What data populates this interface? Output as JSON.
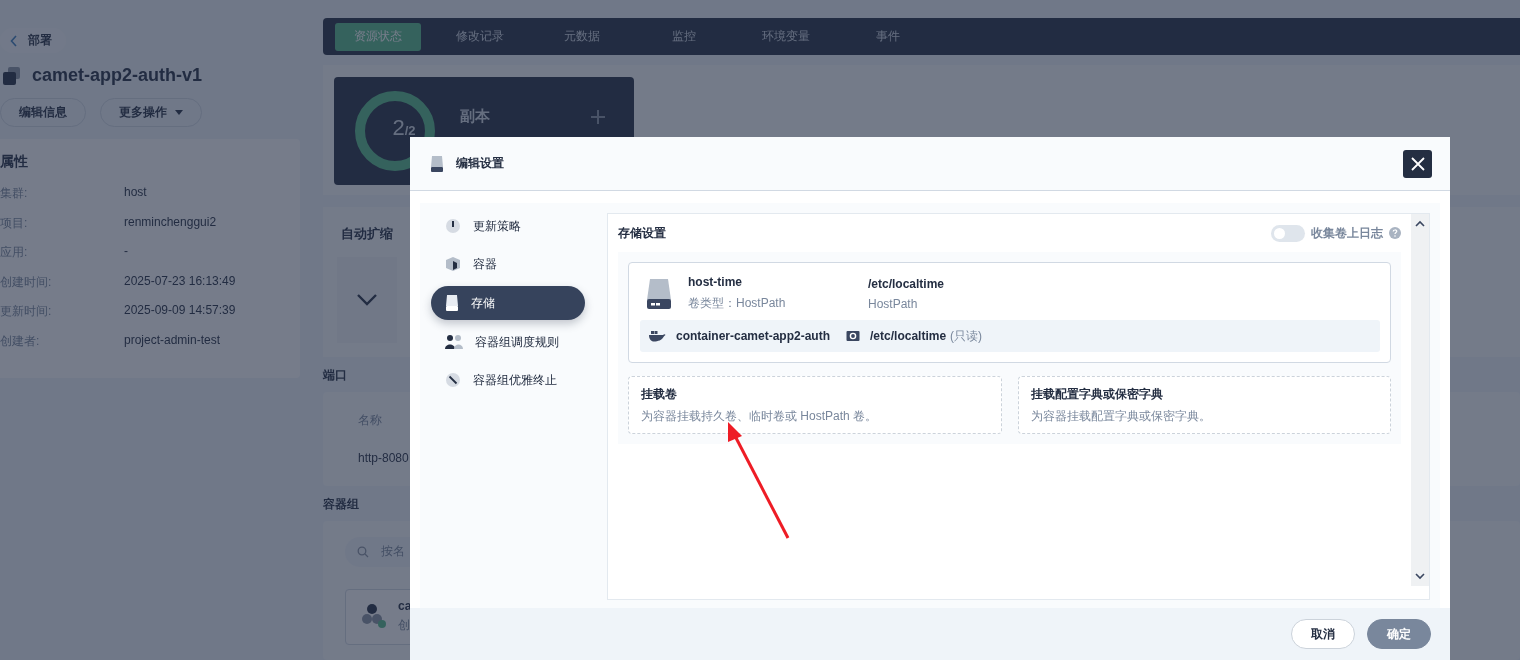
{
  "page": {
    "back_label": "部署",
    "title": "camet-app2-auth-v1",
    "actions": [
      {
        "label": "编辑信息",
        "kind": "plain"
      },
      {
        "label": "更多操作",
        "kind": "dropdown"
      }
    ],
    "properties": {
      "heading": "属性",
      "rows": [
        {
          "label": "集群:",
          "value": "host"
        },
        {
          "label": "项目:",
          "value": "renminchenggui2"
        },
        {
          "label": "应用:",
          "value": "-"
        },
        {
          "label": "创建时间:",
          "value": "2025-07-23 16:13:49"
        },
        {
          "label": "更新时间:",
          "value": "2025-09-09 14:57:39"
        },
        {
          "label": "创建者:",
          "value": "project-admin-test"
        }
      ]
    }
  },
  "tabs": [
    {
      "label": "资源状态",
      "selected": true
    },
    {
      "label": "修改记录",
      "selected": false
    },
    {
      "label": "元数据",
      "selected": false
    },
    {
      "label": "监控",
      "selected": false
    },
    {
      "label": "环境变量",
      "selected": false
    },
    {
      "label": "事件",
      "selected": false
    }
  ],
  "replicas": {
    "current": "2",
    "total": "/2",
    "title": "副本"
  },
  "autoscaling": {
    "title": "自动扩缩"
  },
  "ports": {
    "title": "端口",
    "column": "名称",
    "rows": [
      "http-8080"
    ]
  },
  "pods": {
    "title": "容器组",
    "search_placeholder": "按名",
    "card_name": "ca",
    "card_sub": "创"
  },
  "modal": {
    "title": "编辑设置",
    "nav": [
      {
        "label": "更新策略",
        "kind": "strategy",
        "selected": false
      },
      {
        "label": "容器",
        "kind": "container",
        "selected": false
      },
      {
        "label": "存储",
        "kind": "storage",
        "selected": true
      },
      {
        "label": "容器组调度规则",
        "kind": "schedule",
        "selected": false
      },
      {
        "label": "容器组优雅终止",
        "kind": "terminate",
        "selected": false
      }
    ],
    "section_title": "存储设置",
    "log_toggle": {
      "label": "收集卷上日志",
      "on": false
    },
    "volumes": [
      {
        "name": "host-time",
        "type_label": "卷类型：HostPath",
        "path": "/etc/localtime",
        "path_type": "HostPath",
        "mounts": [
          {
            "container": "container-camet-app2-auth",
            "mount_path": "/etc/localtime",
            "access": "(只读)"
          }
        ]
      }
    ],
    "add_cards": [
      {
        "title": "挂载卷",
        "description": "为容器挂载持久卷、临时卷或 HostPath 卷。"
      },
      {
        "title": "挂载配置字典或保密字典",
        "description": "为容器挂载配置字典或保密字典。"
      }
    ],
    "buttons": [
      {
        "label": "取消",
        "kind": "secondary"
      },
      {
        "label": "确定",
        "kind": "primary"
      }
    ]
  }
}
